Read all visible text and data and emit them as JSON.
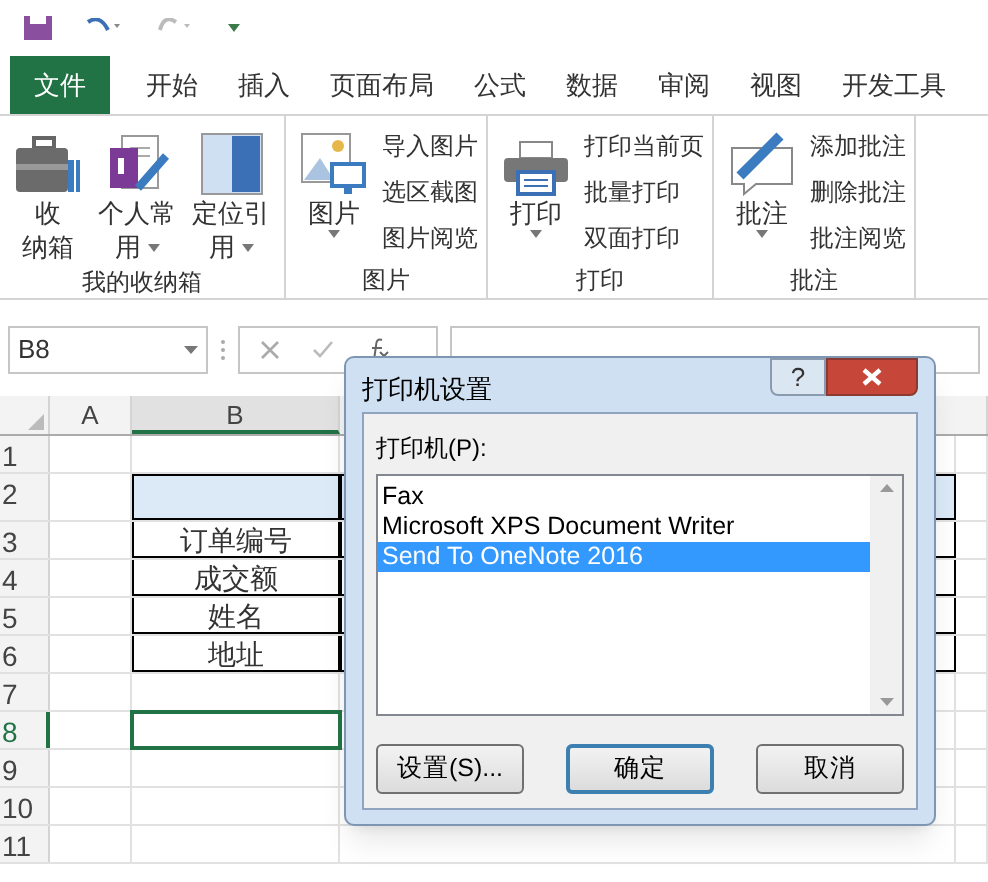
{
  "tabs": [
    {
      "label": "文件",
      "kind": "file",
      "selected": false
    },
    {
      "label": "开始",
      "kind": "tab",
      "selected": false
    },
    {
      "label": "插入",
      "kind": "tab",
      "selected": false
    },
    {
      "label": "页面布局",
      "kind": "tab",
      "selected": false
    },
    {
      "label": "公式",
      "kind": "tab",
      "selected": false
    },
    {
      "label": "数据",
      "kind": "tab",
      "selected": false
    },
    {
      "label": "审阅",
      "kind": "tab",
      "selected": false
    },
    {
      "label": "视图",
      "kind": "tab",
      "selected": false
    },
    {
      "label": "开发工具",
      "kind": "tab",
      "selected": false
    }
  ],
  "ribbon_groups": [
    {
      "label": "我的收纳箱",
      "large": [
        {
          "lines": [
            "收",
            "纳箱"
          ],
          "dropdown": false
        },
        {
          "lines": [
            "个人常",
            "用"
          ],
          "dropdown": true
        },
        {
          "lines": [
            "定位引",
            "用"
          ],
          "dropdown": true
        }
      ]
    },
    {
      "label": "图片",
      "large": [
        {
          "lines": [
            "图片"
          ],
          "dropdown": true
        }
      ],
      "small": [
        "导入图片",
        "选区截图",
        "图片阅览"
      ]
    },
    {
      "label": "打印",
      "large": [
        {
          "lines": [
            "打印"
          ],
          "dropdown": true
        }
      ],
      "small": [
        "打印当前页",
        "批量打印",
        "双面打印"
      ]
    },
    {
      "label": "批注",
      "large": [
        {
          "lines": [
            "批注"
          ],
          "dropdown": true
        }
      ],
      "small": [
        "添加批注",
        "删除批注",
        "批注阅览"
      ]
    }
  ],
  "name_box": {
    "value": "B8"
  },
  "sheet": {
    "columns": [
      "A",
      "B"
    ],
    "rows": [
      {
        "number": "1",
        "selected": false,
        "kind": "plain",
        "cell_b": ""
      },
      {
        "number": "2",
        "selected": false,
        "kind": "header",
        "cell_b": ""
      },
      {
        "number": "3",
        "selected": false,
        "kind": "table",
        "cell_b": "订单编号"
      },
      {
        "number": "4",
        "selected": false,
        "kind": "table",
        "cell_b": "成交额"
      },
      {
        "number": "5",
        "selected": false,
        "kind": "table",
        "cell_b": "姓名"
      },
      {
        "number": "6",
        "selected": false,
        "kind": "table",
        "cell_b": "地址"
      },
      {
        "number": "7",
        "selected": false,
        "kind": "plain",
        "cell_b": ""
      },
      {
        "number": "8",
        "selected": true,
        "kind": "plain",
        "cell_b": ""
      },
      {
        "number": "9",
        "selected": false,
        "kind": "plain",
        "cell_b": ""
      },
      {
        "number": "10",
        "selected": false,
        "kind": "plain",
        "cell_b": ""
      },
      {
        "number": "11",
        "selected": false,
        "kind": "plain",
        "cell_b": ""
      }
    ]
  },
  "dialog": {
    "title": "打印机设置",
    "help": "?",
    "list_label": "打印机(P):",
    "printers": [
      {
        "name": "Fax",
        "selected": false
      },
      {
        "name": "Microsoft XPS Document Writer",
        "selected": false
      },
      {
        "name": "Send To OneNote 2016",
        "selected": true
      }
    ],
    "buttons": [
      {
        "label": "设置(S)...",
        "default": false
      },
      {
        "label": "确定",
        "default": true
      },
      {
        "label": "取消",
        "default": false
      }
    ]
  }
}
